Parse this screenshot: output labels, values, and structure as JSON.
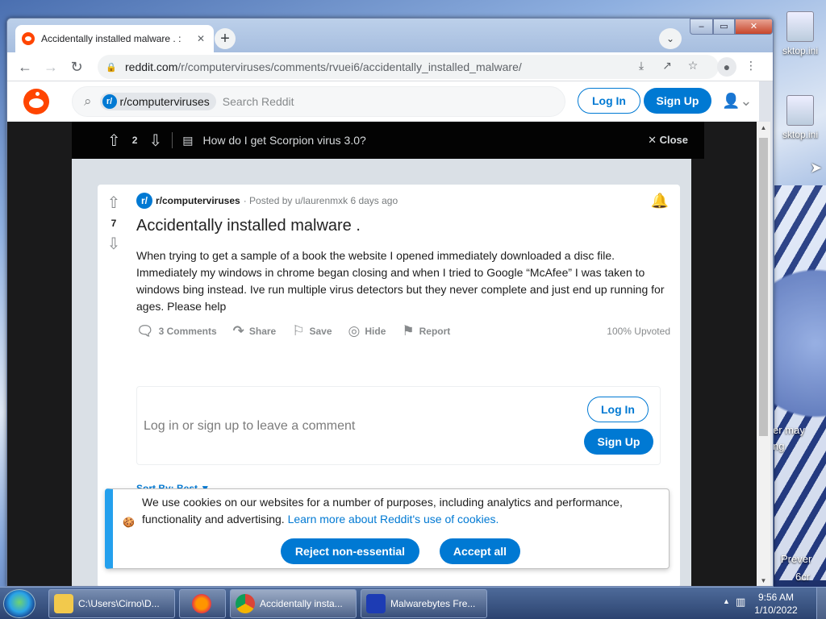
{
  "desktop": {
    "icons": [
      {
        "label": "sktop.ini"
      },
      {
        "label": "sktop.ini"
      }
    ],
    "bg_texts": [
      "er may",
      "ng",
      "Prever",
      "6cr"
    ]
  },
  "browser": {
    "tab": {
      "title": "Accidentally installed malware . :",
      "close": "✕"
    },
    "new_tab": "+",
    "tab_search": "⌄",
    "window_controls": {
      "minimize": "‒",
      "maximize": "▭",
      "close": "✕"
    },
    "nav": {
      "back": "←",
      "forward": "→",
      "reload": "↻"
    },
    "address": {
      "domain": "reddit.com",
      "path": "/r/computerviruses/comments/rvuei6/accidentally_installed_malware/"
    },
    "toolbar_icons": [
      "install-icon",
      "share-icon",
      "star-icon",
      "profile-icon",
      "menu-icon"
    ]
  },
  "reddit": {
    "search": {
      "subreddit_chip": "r/computerviruses",
      "chip_avatar": "r/",
      "placeholder": "Search Reddit"
    },
    "login_label": "Log In",
    "signup_label": "Sign Up",
    "post_bar": {
      "votes": "2",
      "title": "How do I get Scorpion virus 3.0?",
      "close_label": "Close"
    },
    "post": {
      "votes": "7",
      "subreddit": "r/computerviruses",
      "meta": "· Posted by u/laurenmxk 6 days ago",
      "title": "Accidentally installed malware .",
      "body": "When trying to get a sample of a book the website I opened immediately downloaded a disc file. Immediately my windows in chrome began closing and when I tried to Google “McAfee” I was taken to windows bing instead. Ive run multiple virus detectors but they never complete and just end up running for ages. Please help",
      "actions": {
        "comments": "3 Comments",
        "share": "Share",
        "save": "Save",
        "hide": "Hide",
        "report": "Report"
      },
      "upvoted": "100% Upvoted"
    },
    "comment_box": {
      "message": "Log in or sign up to leave a comment",
      "login": "Log In",
      "signup": "Sign Up"
    },
    "sort_by": "Sort By: Best"
  },
  "cookie_banner": {
    "text": "We use cookies on our websites for a number of purposes, including analytics and performance, functionality and advertising.",
    "link": "Learn more about Reddit's use of cookies.",
    "reject": "Reject non-essential",
    "accept": "Accept all"
  },
  "taskbar": {
    "items": [
      {
        "label": "C:\\Users\\Cirno\\D..."
      },
      {
        "label": ""
      },
      {
        "label": "Accidentally insta..."
      },
      {
        "label": "Malwarebytes Fre..."
      }
    ],
    "time": "9:56 AM",
    "date": "1/10/2022"
  },
  "colors": {
    "reddit_orange": "#ff4500",
    "reddit_blue": "#0079d3",
    "cookie_accent": "#24a0ed"
  }
}
